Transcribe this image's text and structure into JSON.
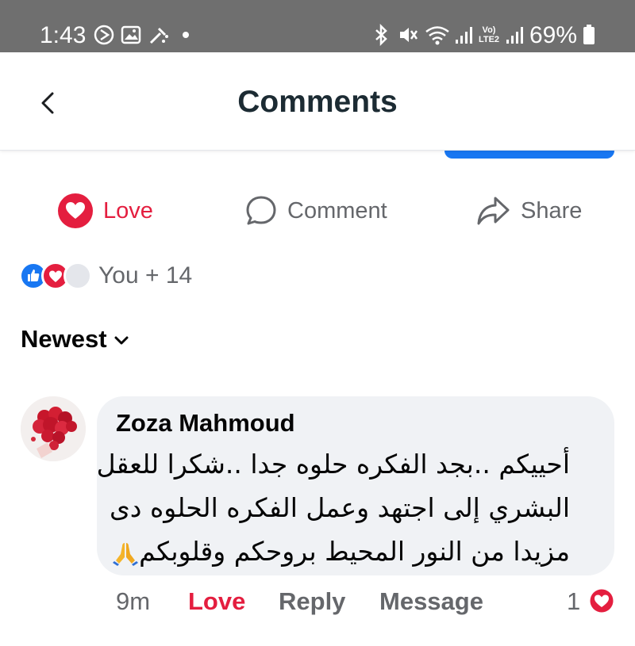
{
  "status_bar": {
    "time": "1:43",
    "network_label": "Vo) LTE2",
    "battery": "69%"
  },
  "header": {
    "title": "Comments"
  },
  "actions": {
    "love": "Love",
    "comment": "Comment",
    "share": "Share"
  },
  "reactions": {
    "summary": "You + 14",
    "icons": [
      "like-icon",
      "love-icon",
      "care-icon"
    ]
  },
  "sort": {
    "label": "Newest"
  },
  "comment": {
    "author": "Zoza Mahmoud",
    "lines": [
      "أحييكم ..بجد الفكره حلوه جدا ..شكرا للعقل",
      "البشري إلى اجتهد وعمل الفكره الحلوه دى",
      "مزيدا من النور المحيط بروحكم وقلوبكم"
    ],
    "emoji": "folded-hands-icon",
    "time": "9m",
    "love_label": "Love",
    "reply_label": "Reply",
    "message_label": "Message",
    "reaction_count": "1"
  },
  "colors": {
    "status_bar": "#6f6f6f",
    "brand_blue": "#1877f2",
    "love_red": "#e41e3f",
    "bubble_bg": "#f0f2f5",
    "muted_text": "#65676b"
  }
}
